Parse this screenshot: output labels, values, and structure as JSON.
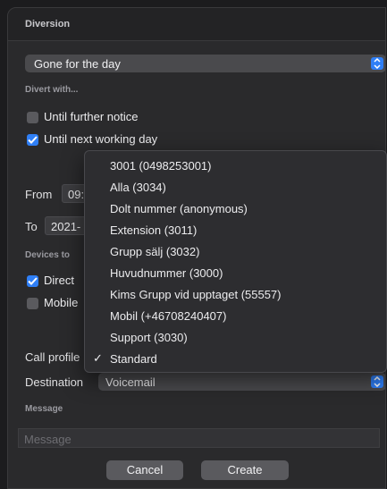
{
  "title": "Diversion",
  "diversion_select": {
    "value": "Gone for the day"
  },
  "divert_with": {
    "label": "Divert with...",
    "options": [
      {
        "label": "Until further notice",
        "checked": false
      },
      {
        "label": "Until next working day",
        "checked": true
      }
    ]
  },
  "from": {
    "label": "From",
    "value": "09:"
  },
  "to": {
    "label": "To",
    "value": "2021-"
  },
  "devices": {
    "label": "Devices to",
    "items": [
      {
        "label": "Direct",
        "checked": true
      },
      {
        "label": "Mobile",
        "checked": false
      }
    ]
  },
  "call_profile": {
    "label": "Call profile"
  },
  "destination": {
    "label": "Destination",
    "value": "Voicemail"
  },
  "message": {
    "label": "Message",
    "placeholder": "Message"
  },
  "buttons": {
    "cancel": "Cancel",
    "create": "Create"
  },
  "dropdown": {
    "items": [
      {
        "label": "3001 (0498253001)",
        "selected": false
      },
      {
        "label": "Alla (3034)",
        "selected": false
      },
      {
        "label": "Dolt nummer (anonymous)",
        "selected": false
      },
      {
        "label": "Extension (3011)",
        "selected": false
      },
      {
        "label": "Grupp sälj (3032)",
        "selected": false
      },
      {
        "label": "Huvudnummer (3000)",
        "selected": false
      },
      {
        "label": "Kims Grupp vid upptaget (55557)",
        "selected": false
      },
      {
        "label": "Mobil (+46708240407)",
        "selected": false
      },
      {
        "label": "Support (3030)",
        "selected": false
      },
      {
        "label": "Standard",
        "selected": true,
        "mark": "✓"
      }
    ]
  },
  "colors": {
    "accent": "#2f7ff6",
    "panel": "#2a2a2c",
    "background": "#1c1c1e"
  }
}
